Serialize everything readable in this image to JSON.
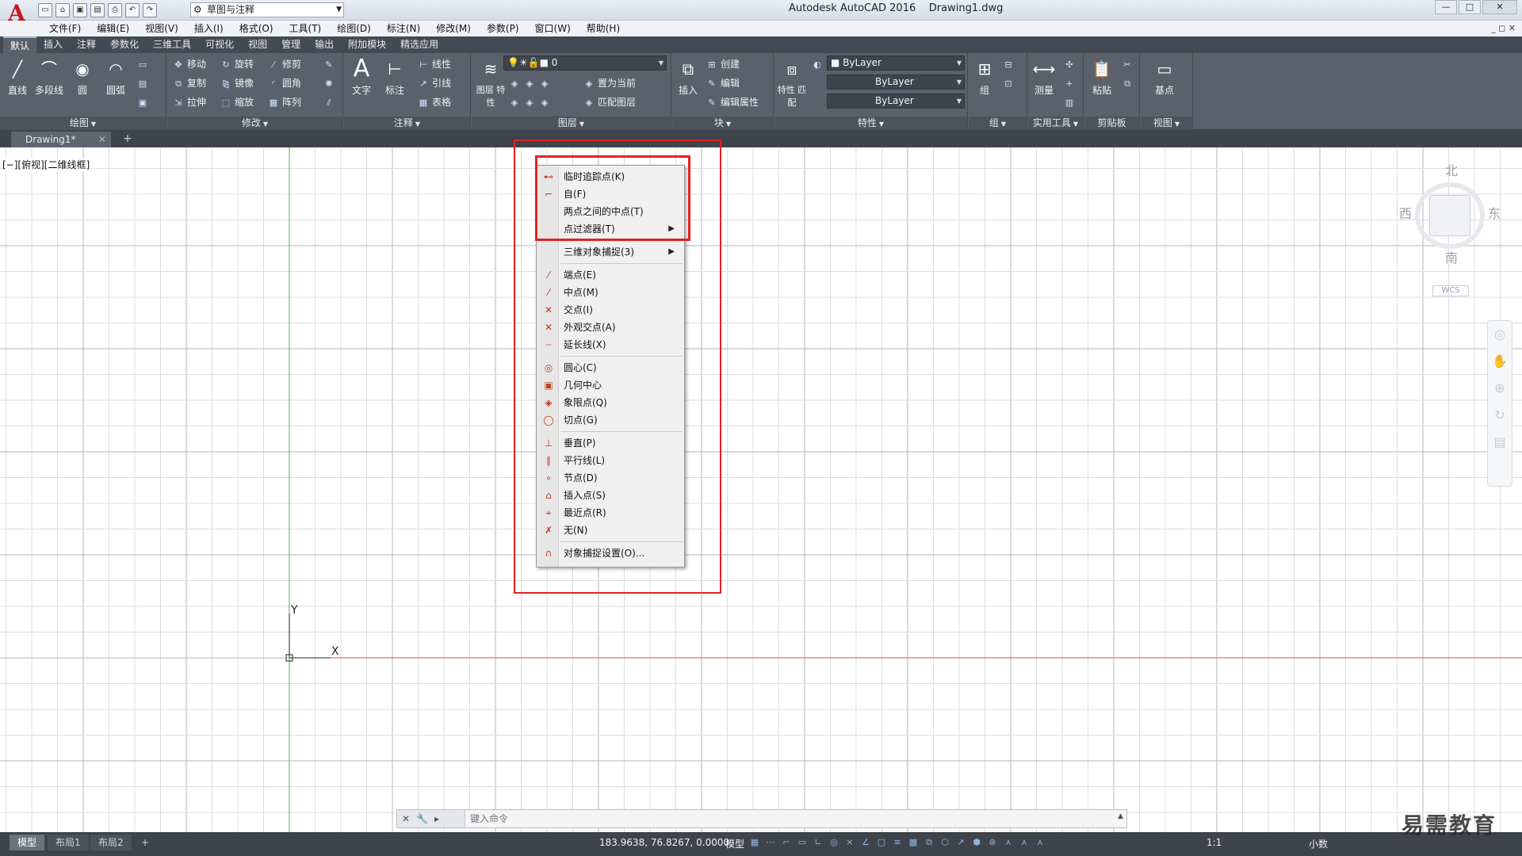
{
  "app": {
    "title": "Autodesk AutoCAD 2016    Drawing1.dwg",
    "logo_letter": "A",
    "workspace": "草图与注释",
    "window_controls": [
      "—",
      "□",
      "✕"
    ]
  },
  "menubar": {
    "items": [
      "文件(F)",
      "编辑(E)",
      "视图(V)",
      "插入(I)",
      "格式(O)",
      "工具(T)",
      "绘图(D)",
      "标注(N)",
      "修改(M)",
      "参数(P)",
      "窗口(W)",
      "帮助(H)"
    ],
    "right": "_ ◻ ✕"
  },
  "ribbon_tabs": [
    "默认",
    "插入",
    "注释",
    "参数化",
    "三维工具",
    "可视化",
    "视图",
    "管理",
    "输出",
    "附加模块",
    "精选应用"
  ],
  "ribbon": {
    "draw": {
      "title": "绘图",
      "line": "直线",
      "polyline": "多段线",
      "circle": "圆",
      "arc": "圆弧"
    },
    "modify": {
      "title": "修改",
      "move": "移动",
      "rotate": "旋转",
      "trim": "修剪",
      "copy": "复制",
      "mirror": "镜像",
      "fillet": "圆角",
      "stretch": "拉伸",
      "scale": "缩放",
      "array": "阵列"
    },
    "annotation": {
      "title": "注释",
      "text": "文字",
      "dimension": "标注",
      "linear": "线性",
      "leader": "引线",
      "table": "表格"
    },
    "layers": {
      "title": "图层",
      "properties": "图层\n特性",
      "current_layer": "0",
      "set_current": "置为当前",
      "match_layer": "匹配图层"
    },
    "block": {
      "title": "块",
      "insert": "插入",
      "create": "创建",
      "edit": "编辑",
      "edit_attr": "编辑属性"
    },
    "properties": {
      "title": "特性",
      "match": "特性\n匹配",
      "color": "ByLayer",
      "linetype": "ByLayer",
      "lineweight": "ByLayer"
    },
    "groups": {
      "title": "组",
      "group": "组"
    },
    "utilities": {
      "title": "实用工具",
      "measure": "测量"
    },
    "clipboard": {
      "title": "剪贴板",
      "paste": "粘贴"
    },
    "view": {
      "title": "视图",
      "base": "基点"
    }
  },
  "document": {
    "tab": "Drawing1*",
    "new_tab": "+"
  },
  "viewport": {
    "label": "[−][俯视][二维线框]",
    "ucs_x": "X",
    "ucs_y": "Y",
    "viewcube": {
      "north": "北",
      "south": "南",
      "east": "东",
      "west": "西",
      "wcs": "WCS"
    }
  },
  "context_menu": {
    "items": [
      {
        "label": "临时追踪点(K)",
        "icon": "temp-track-icon",
        "glyph": "⊷"
      },
      {
        "label": "自(F)",
        "icon": "from-icon",
        "glyph": "⌐"
      },
      {
        "label": "两点之间的中点(T)",
        "icon": "",
        "glyph": ""
      },
      {
        "label": "点过滤器(T)",
        "icon": "",
        "glyph": "",
        "submenu": true
      },
      {
        "sep": true
      },
      {
        "label": "三维对象捕捉(3)",
        "icon": "",
        "glyph": "",
        "submenu": true
      },
      {
        "sep": true
      },
      {
        "label": "端点(E)",
        "icon": "endpoint-icon",
        "glyph": "⁄"
      },
      {
        "label": "中点(M)",
        "icon": "midpoint-icon",
        "glyph": "⁄"
      },
      {
        "label": "交点(I)",
        "icon": "intersection-icon",
        "glyph": "✕"
      },
      {
        "label": "外观交点(A)",
        "icon": "apparent-intersection-icon",
        "glyph": "✕"
      },
      {
        "label": "延长线(X)",
        "icon": "extension-icon",
        "glyph": "┈"
      },
      {
        "sep": true
      },
      {
        "label": "圆心(C)",
        "icon": "center-icon",
        "glyph": "◎"
      },
      {
        "label": "几何中心",
        "icon": "geometric-center-icon",
        "glyph": "▣"
      },
      {
        "label": "象限点(Q)",
        "icon": "quadrant-icon",
        "glyph": "◈"
      },
      {
        "label": "切点(G)",
        "icon": "tangent-icon",
        "glyph": "◯"
      },
      {
        "sep": true
      },
      {
        "label": "垂直(P)",
        "icon": "perpendicular-icon",
        "glyph": "⊥"
      },
      {
        "label": "平行线(L)",
        "icon": "parallel-icon",
        "glyph": "∥"
      },
      {
        "label": "节点(D)",
        "icon": "node-icon",
        "glyph": "∘"
      },
      {
        "label": "插入点(S)",
        "icon": "insertion-icon",
        "glyph": "⌂"
      },
      {
        "label": "最近点(R)",
        "icon": "nearest-icon",
        "glyph": "⌖"
      },
      {
        "label": "无(N)",
        "icon": "none-icon",
        "glyph": "✗"
      },
      {
        "sep": true
      },
      {
        "label": "对象捕捉设置(O)...",
        "icon": "osnap-settings-icon",
        "glyph": "∩"
      }
    ]
  },
  "command_line": {
    "placeholder": "键入命令"
  },
  "statusbar": {
    "tabs": [
      "模型",
      "布局1",
      "布局2"
    ],
    "add": "+",
    "coords": "183.9638, 76.8267, 0.0000",
    "model": "模型",
    "scale": "1:1",
    "units": "小数"
  },
  "watermark": "易需教育",
  "colors": {
    "highlight": "#e22222",
    "ribbon": "#5a616c",
    "y_axis": "#4caf50",
    "x_axis": "#d9534f",
    "grid": "#d4d4d4"
  }
}
